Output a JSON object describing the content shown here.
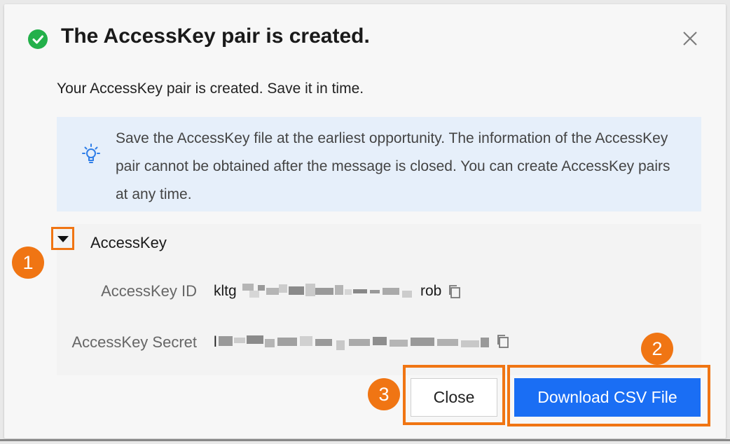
{
  "dialog": {
    "title": "The AccessKey pair is created.",
    "subtitle": "Your AccessKey pair is created. Save it in time.",
    "tip": "Save the AccessKey file at the earliest opportunity. The information of the AccessKey pair cannot be obtained after the message is closed. You can create AccessKey pairs at any time.",
    "section_label": "AccessKey",
    "fields": [
      {
        "label": "AccessKey ID",
        "prefix": "kltg",
        "suffix": "rob"
      },
      {
        "label": "AccessKey Secret",
        "prefix": "l",
        "suffix": ""
      }
    ],
    "buttons": {
      "close": "Close",
      "download": "Download CSV File"
    }
  },
  "annotations": [
    "1",
    "2",
    "3"
  ],
  "colors": {
    "accent_orange": "#f07513",
    "primary_blue": "#1a6ef4",
    "success_green": "#23b04a",
    "tip_bg": "#e6effa"
  },
  "icons": {
    "status": "check-circle-icon",
    "close": "close-icon",
    "tip": "lightbulb-icon",
    "toggle": "caret-down-icon",
    "copy": "copy-icon"
  }
}
